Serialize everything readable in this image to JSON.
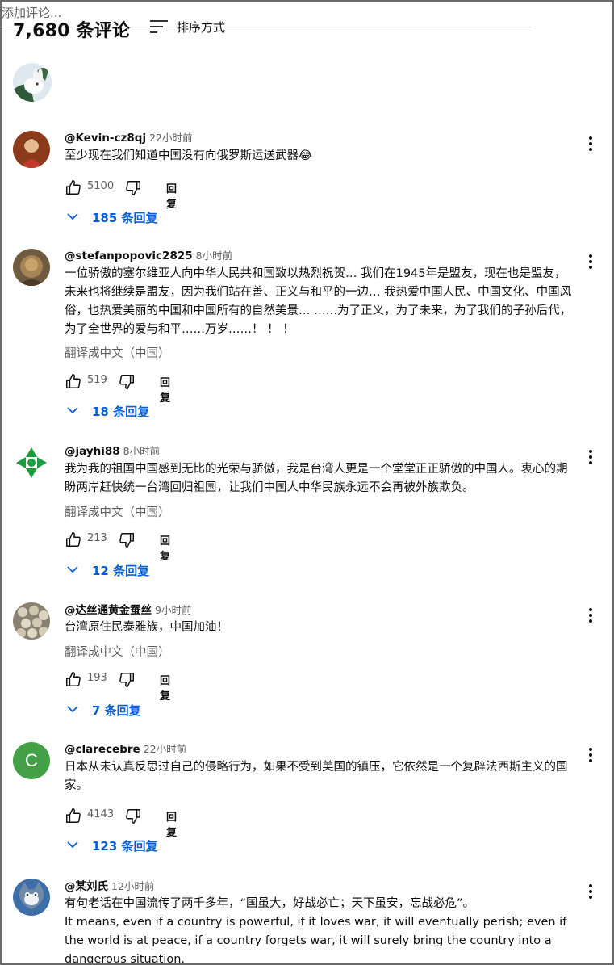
{
  "header": {
    "comment_count": "7,680 条评论",
    "sort_label": "排序方式"
  },
  "composer": {
    "placeholder": "添加评论..."
  },
  "labels": {
    "reply": "回复"
  },
  "colors": {
    "accent": "#065fd4",
    "secondary_text": "#606060",
    "avatar_c": "#43a047"
  },
  "comments": [
    {
      "author": "@Kevin-cz8qj",
      "time": "22小时前",
      "text": "至少现在我们知道中国没有向俄罗斯运送武器😂",
      "translate": "",
      "likes": "5100",
      "replies": "185 条回复",
      "avatar_icon": "portrait-avatar"
    },
    {
      "author": "@stefanpopovic2825",
      "time": "8小时前",
      "text": "一位骄傲的塞尔维亚人向中华人民共和国致以热烈祝贺… 我们在1945年是盟友，现在也是盟友，未来也将继续是盟友，因为我们站在善、正义与和平的一边… 我热爱中国人民、中国文化、中国风俗，也热爱美丽的中国和中国所有的自然美景… ……为了正义，为了未来，为了我们的子孙后代，为了全世界的爱与和平……万岁……！ ！ ！",
      "translate": "翻译成中文（中国）",
      "likes": "519",
      "replies": "18 条回复",
      "avatar_icon": "statue-avatar"
    },
    {
      "author": "@jayhi88",
      "time": "8小时前",
      "text": "我为我的祖国中国感到无比的光荣与骄傲，我是台湾人更是一个堂堂正正骄傲的中国人。衷心的期盼两岸赶快统一台湾回归祖国，让我们中国人中华民族永远不会再被外族欺负。",
      "translate": "翻译成中文（中国）",
      "likes": "213",
      "replies": "12 条回复",
      "avatar_icon": "green-emblem-avatar"
    },
    {
      "author": "@达丝通黄金蚕丝",
      "time": "9小时前",
      "text": "台湾原住民泰雅族，中国加油！",
      "translate": "翻译成中文（中国）",
      "likes": "193",
      "replies": "7 条回复",
      "avatar_icon": "cocoons-avatar"
    },
    {
      "author": "@clarecebre",
      "time": "22小时前",
      "text": "日本从未认真反思过自己的侵略行为，如果不受到美国的镇压，它依然是一个复辟法西斯主义的国家。",
      "translate": "",
      "likes": "4143",
      "replies": "123 条回复",
      "avatar_letter": "C"
    },
    {
      "author": "@某刘氏",
      "time": "12小时前",
      "text": "有句老话在中国流传了两千多年，“国虽大，好战必亡；天下虽安，忘战必危”。\nIt means, even if a country is powerful, if it loves war, it will eventually perish; even if the world is at peace, if a country forgets war, it will surely bring the country into a dangerous situation.",
      "translate": "",
      "likes": "",
      "replies": "",
      "avatar_icon": "cartoon-cat-avatar"
    }
  ]
}
